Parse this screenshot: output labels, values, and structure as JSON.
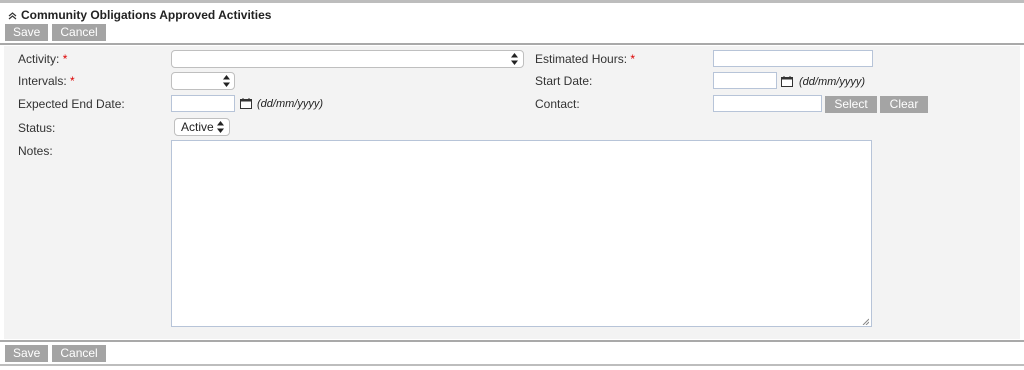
{
  "section": {
    "title": "Community Obligations Approved Activities",
    "icon": "chevron-up-icon"
  },
  "toolbar_top": {
    "save": "Save",
    "cancel": "Cancel"
  },
  "toolbar_bottom": {
    "save": "Save",
    "cancel": "Cancel"
  },
  "form": {
    "activity": {
      "label": "Activity:",
      "required": "*",
      "value": ""
    },
    "intervals": {
      "label": "Intervals:",
      "required": "*",
      "value": ""
    },
    "expected_end_date": {
      "label": "Expected End Date:",
      "value": "",
      "format": "(dd/mm/yyyy)"
    },
    "status": {
      "label": "Status:",
      "value": "Active"
    },
    "notes": {
      "label": "Notes:",
      "value": ""
    },
    "estimated_hours": {
      "label": "Estimated Hours:",
      "required": "*",
      "value": ""
    },
    "start_date": {
      "label": "Start Date:",
      "value": "",
      "format": "(dd/mm/yyyy)"
    },
    "contact": {
      "label": "Contact:",
      "value": "",
      "select_label": "Select",
      "clear_label": "Clear"
    }
  },
  "colors": {
    "button_bg": "#a4a4a4",
    "form_bg": "#f3f3f3",
    "required": "#dd0000",
    "field_border": "#b7c4d8"
  }
}
